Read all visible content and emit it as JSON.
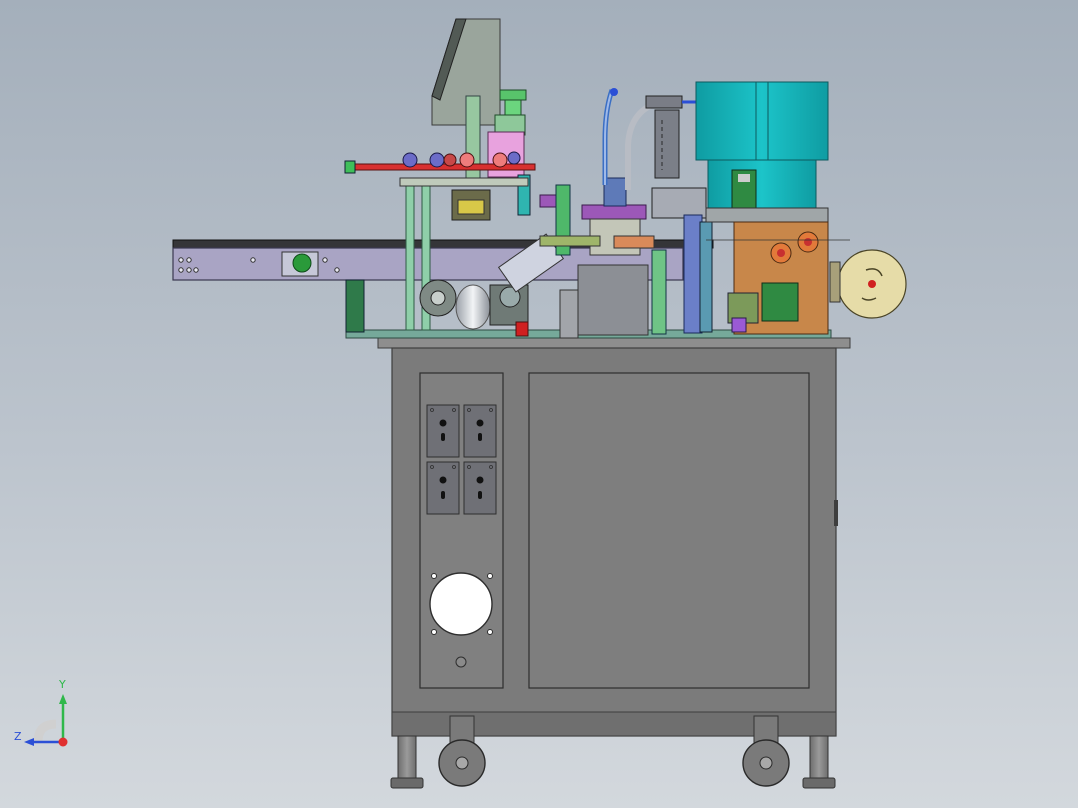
{
  "viewport": {
    "background_top": "#a4afbb",
    "background_bottom": "#d3d8dd"
  },
  "triad": {
    "y_label": "Y",
    "z_label": "Z",
    "y_color": "#2fb84a",
    "z_color": "#2b4fd6",
    "x_color": "#e03030"
  },
  "colors": {
    "frame_gray": "#7d7d7d",
    "frame_edge": "#4a4a4a",
    "panel_gray": "#8a8a8a",
    "teal_hopper": "#17b3b8",
    "orange_block": "#c8874a",
    "cream_wheel": "#e6dca8",
    "lavender_conveyor": "#a9a4c4",
    "green_part": "#3fbf5a",
    "pink_part": "#e09ad6",
    "red_rod": "#d83030"
  }
}
